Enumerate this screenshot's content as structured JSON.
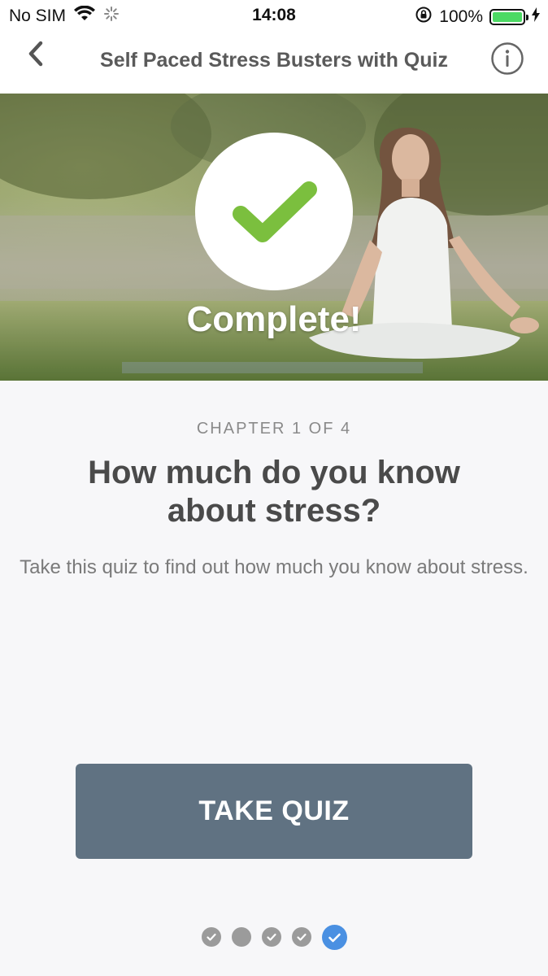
{
  "status_bar": {
    "carrier": "No SIM",
    "time": "14:08",
    "battery": "100%"
  },
  "nav": {
    "title": "Self Paced Stress Busters with Quiz",
    "back_icon": "chevron-left-icon",
    "info_icon": "info-icon"
  },
  "hero": {
    "status_label": "Complete!",
    "check_icon": "checkmark-icon"
  },
  "content": {
    "chapter_label": "CHAPTER 1 OF 4",
    "title": "How much do you know about stress?",
    "description": "Take this quiz to find out how much you know about stress."
  },
  "actions": {
    "take_quiz_label": "TAKE QUIZ"
  },
  "pager": {
    "dots": [
      {
        "state": "completed"
      },
      {
        "state": "empty"
      },
      {
        "state": "completed"
      },
      {
        "state": "completed"
      },
      {
        "state": "current-completed"
      }
    ]
  },
  "colors": {
    "accent_green": "#7bbf3e",
    "button": "#607282",
    "active_dot": "#4a90e2",
    "dot": "#9b9b9b"
  }
}
